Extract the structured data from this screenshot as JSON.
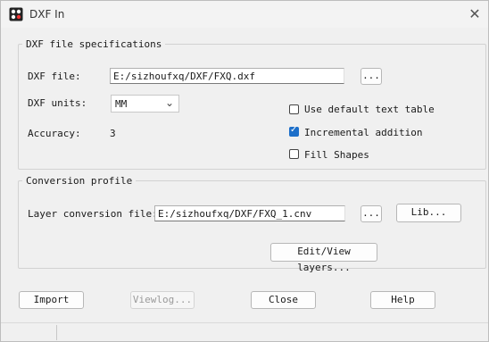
{
  "window": {
    "title": "DXF In",
    "app_icon": "autocad-dxf-app-icon",
    "close_icon": "close-icon"
  },
  "specs": {
    "legend": "DXF file specifications",
    "file_label": "DXF file:",
    "file_value": "E:/sizhoufxq/DXF/FXQ.dxf",
    "browse_label": "...",
    "units_label": "DXF units:",
    "units_value": "MM",
    "accuracy_label": "Accuracy:",
    "accuracy_value": "3",
    "checkboxes": [
      {
        "label": "Use default text table",
        "checked": false
      },
      {
        "label": "Incremental addition",
        "checked": true
      },
      {
        "label": "Fill Shapes",
        "checked": false
      }
    ]
  },
  "conversion": {
    "legend": "Conversion profile",
    "layer_label": "Layer conversion file:",
    "layer_value": "E:/sizhoufxq/DXF/FXQ_1.cnv",
    "browse_label": "...",
    "lib_label": "Lib...",
    "edit_label": "Edit/View layers..."
  },
  "buttons": {
    "import": "Import",
    "viewlog": "Viewlog...",
    "close": "Close",
    "help": "Help"
  }
}
